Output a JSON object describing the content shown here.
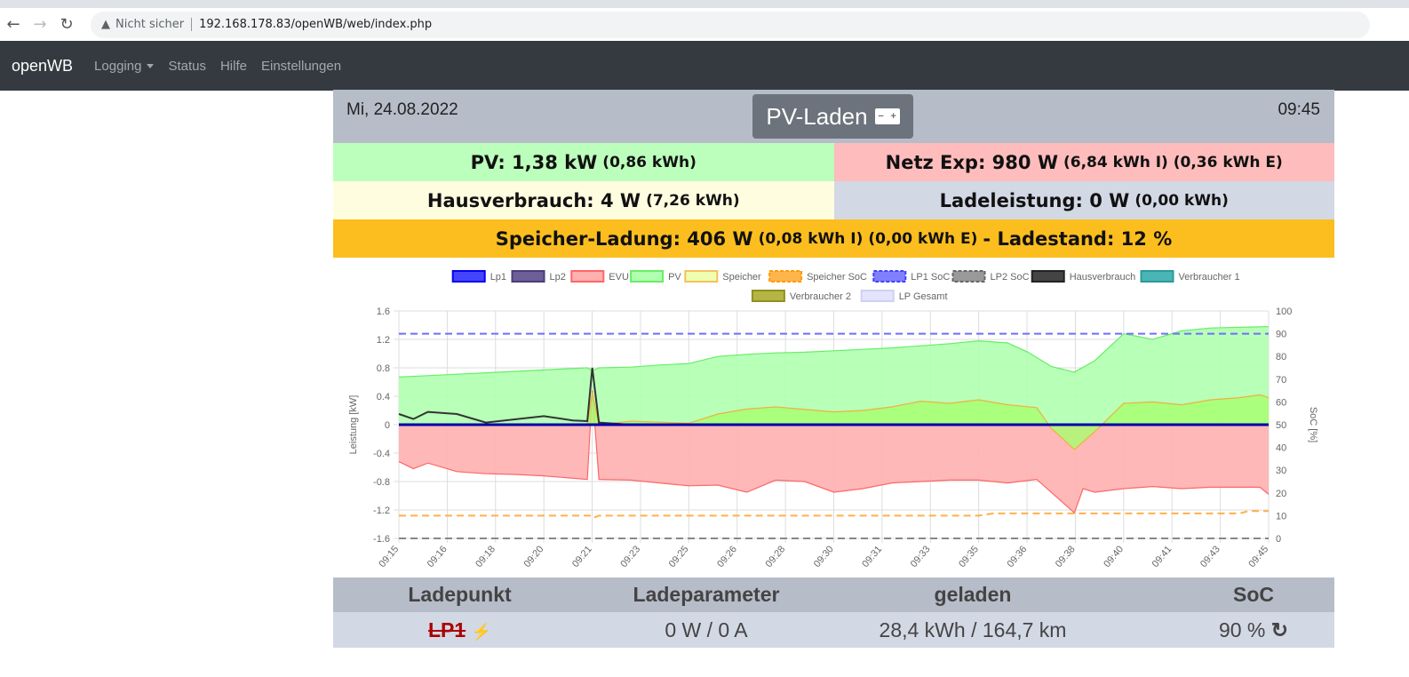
{
  "browser": {
    "security": "Nicht sicher",
    "url": "192.168.178.83/openWB/web/index.php"
  },
  "navbar": {
    "brand": "openWB",
    "items": [
      "Logging",
      "Status",
      "Hilfe",
      "Einstellungen"
    ]
  },
  "header": {
    "date": "Mi, 24.08.2022",
    "mode": "PV-Laden",
    "time": "09:45"
  },
  "stats": {
    "pv": "PV: 1,38 kW",
    "pv_sub": "(0,86 kWh)",
    "netz": "Netz Exp: 980 W",
    "netz_sub": "(6,84 kWh I) (0,36 kWh E)",
    "haus": "Hausverbrauch: 4 W",
    "haus_sub": "(7,26 kWh)",
    "lade": "Ladeleistung: 0 W",
    "lade_sub": "(0,00 kWh)",
    "speicher": "Speicher-Ladung: 406 W",
    "speicher_sub": "(0,08 kWh I) (0,00 kWh E)",
    "ladestand": "- Ladestand: 12 %"
  },
  "colors": {
    "pv": "#bcffbc",
    "netz": "#ffbcbc",
    "haus": "#fffde0",
    "lade": "#d3d8e5",
    "speicher": "#fcbe1e"
  },
  "chart_data": {
    "type": "line",
    "ylabel": "Leistung [kW]",
    "y2label": "SoC [%]",
    "ylim": [
      -1.6,
      1.6
    ],
    "y2lim": [
      0,
      100
    ],
    "yticks": [
      "1.6",
      "1.2",
      "0.8",
      "0.4",
      "0",
      "-0.4",
      "-0.8",
      "-1.2",
      "-1.6"
    ],
    "y2ticks": [
      "100",
      "90",
      "80",
      "70",
      "60",
      "50",
      "40",
      "30",
      "20",
      "10",
      "0"
    ],
    "xticks": [
      "09:15",
      "09:16",
      "09:18",
      "09:20",
      "09:21",
      "09:23",
      "09:25",
      "09:26",
      "09:28",
      "09:30",
      "09:31",
      "09:33",
      "09:35",
      "09:36",
      "09:38",
      "09:40",
      "09:41",
      "09:43",
      "09:45"
    ],
    "xrange_min": [
      0,
      30
    ],
    "legend": [
      {
        "name": "Lp1",
        "fill": "#4444ff",
        "stroke": "#0000ee",
        "dash": false
      },
      {
        "name": "Lp2",
        "fill": "#6c5e96",
        "stroke": "#4a3d78",
        "dash": false
      },
      {
        "name": "EVU",
        "fill": "#ffb0b0",
        "stroke": "#ff6666",
        "dash": false
      },
      {
        "name": "PV",
        "fill": "#b0ffb0",
        "stroke": "#66ee66",
        "dash": false
      },
      {
        "name": "Speicher",
        "fill": "#eeffb0",
        "stroke": "#f5c060",
        "dash": false
      },
      {
        "name": "Speicher SoC",
        "fill": "#ffb44c",
        "stroke": "#ff9900",
        "dash": true
      },
      {
        "name": "LP1 SoC",
        "fill": "#8080ff",
        "stroke": "#4040ff",
        "dash": true
      },
      {
        "name": "LP2 SoC",
        "fill": "#999999",
        "stroke": "#666666",
        "dash": true
      },
      {
        "name": "Hausverbrauch",
        "fill": "#444444",
        "stroke": "#222222",
        "dash": false
      },
      {
        "name": "Verbraucher 1",
        "fill": "#4bb5b5",
        "stroke": "#2a9a9a",
        "dash": false
      },
      {
        "name": "Verbraucher 2",
        "fill": "#b5b545",
        "stroke": "#909020",
        "dash": false
      },
      {
        "name": "LP Gesamt",
        "fill": "#e4e4ff",
        "stroke": "#d0d0f0",
        "dash": false
      }
    ],
    "series": {
      "PV": [
        [
          0,
          0.67
        ],
        [
          1,
          0.69
        ],
        [
          2,
          0.71
        ],
        [
          3,
          0.73
        ],
        [
          4,
          0.75
        ],
        [
          5,
          0.77
        ],
        [
          6.5,
          0.8
        ],
        [
          6.67,
          0.76
        ],
        [
          6.9,
          0.8
        ],
        [
          8,
          0.81
        ],
        [
          9,
          0.84
        ],
        [
          10,
          0.86
        ],
        [
          11,
          0.96
        ],
        [
          12,
          0.99
        ],
        [
          13,
          1.01
        ],
        [
          14,
          1.02
        ],
        [
          15,
          1.04
        ],
        [
          16,
          1.06
        ],
        [
          17,
          1.08
        ],
        [
          18,
          1.11
        ],
        [
          19,
          1.14
        ],
        [
          20,
          1.18
        ],
        [
          21,
          1.15
        ],
        [
          21.7,
          1.02
        ],
        [
          22.5,
          0.82
        ],
        [
          23.3,
          0.74
        ],
        [
          24,
          0.9
        ],
        [
          25,
          1.28
        ],
        [
          26,
          1.2
        ],
        [
          27,
          1.32
        ],
        [
          28,
          1.36
        ],
        [
          29,
          1.37
        ],
        [
          30,
          1.38
        ]
      ],
      "EVU": [
        [
          0,
          -0.52
        ],
        [
          0.5,
          -0.62
        ],
        [
          1,
          -0.54
        ],
        [
          2,
          -0.66
        ],
        [
          3,
          -0.69
        ],
        [
          4,
          -0.7
        ],
        [
          5,
          -0.72
        ],
        [
          6.5,
          -0.77
        ],
        [
          6.67,
          0.48
        ],
        [
          6.9,
          -0.77
        ],
        [
          8,
          -0.78
        ],
        [
          9,
          -0.82
        ],
        [
          10,
          -0.86
        ],
        [
          11,
          -0.85
        ],
        [
          12,
          -0.95
        ],
        [
          13,
          -0.78
        ],
        [
          14,
          -0.8
        ],
        [
          15,
          -0.95
        ],
        [
          16,
          -0.9
        ],
        [
          17,
          -0.82
        ],
        [
          18,
          -0.8
        ],
        [
          19,
          -0.78
        ],
        [
          20,
          -0.78
        ],
        [
          21,
          -0.82
        ],
        [
          22,
          -0.77
        ],
        [
          23.3,
          -1.24
        ],
        [
          23.6,
          -0.9
        ],
        [
          24,
          -0.95
        ],
        [
          25,
          -0.9
        ],
        [
          26,
          -0.87
        ],
        [
          27,
          -0.9
        ],
        [
          28,
          -0.88
        ],
        [
          29,
          -0.88
        ],
        [
          29.7,
          -0.88
        ],
        [
          30,
          -0.98
        ]
      ],
      "Speicher": [
        [
          0,
          0
        ],
        [
          6.5,
          0
        ],
        [
          6.67,
          0.45
        ],
        [
          6.9,
          0
        ],
        [
          8,
          0.05
        ],
        [
          10,
          0.02
        ],
        [
          11,
          0.15
        ],
        [
          12,
          0.22
        ],
        [
          13,
          0.25
        ],
        [
          15,
          0.18
        ],
        [
          16,
          0.2
        ],
        [
          17,
          0.25
        ],
        [
          18,
          0.33
        ],
        [
          19,
          0.3
        ],
        [
          20,
          0.35
        ],
        [
          21,
          0.28
        ],
        [
          22,
          0.24
        ],
        [
          22.5,
          -0.05
        ],
        [
          23.3,
          -0.35
        ],
        [
          24,
          -0.1
        ],
        [
          25,
          0.3
        ],
        [
          26,
          0.32
        ],
        [
          27,
          0.28
        ],
        [
          28,
          0.35
        ],
        [
          29,
          0.38
        ],
        [
          29.7,
          0.42
        ],
        [
          30,
          0.38
        ]
      ],
      "Hausverbrauch": [
        [
          0,
          0.15
        ],
        [
          0.5,
          0.08
        ],
        [
          1,
          0.18
        ],
        [
          2,
          0.15
        ],
        [
          3,
          0.03
        ],
        [
          5,
          0.12
        ],
        [
          6,
          0.06
        ],
        [
          6.5,
          0.05
        ],
        [
          6.67,
          0.8
        ],
        [
          6.9,
          0.03
        ],
        [
          8,
          0
        ],
        [
          30,
          0
        ]
      ],
      "Lp1": [
        [
          0,
          0
        ],
        [
          30,
          0
        ]
      ],
      "LP1 SoC": [
        [
          0,
          90
        ],
        [
          30,
          90
        ]
      ],
      "Speicher SoC": [
        [
          0,
          10
        ],
        [
          6.6,
          10
        ],
        [
          6.7,
          9
        ],
        [
          6.9,
          10
        ],
        [
          20,
          10
        ],
        [
          20.5,
          11
        ],
        [
          29,
          11
        ],
        [
          29.3,
          12
        ],
        [
          30,
          12
        ]
      ],
      "LP2 SoC": [
        [
          0,
          0
        ],
        [
          30,
          0
        ]
      ]
    }
  },
  "table": {
    "headers": [
      "Ladepunkt",
      "Ladeparameter",
      "geladen",
      "SoC"
    ],
    "row": {
      "name": "LP1",
      "params": "0 W / 0 A",
      "charged": "28,4 kWh / 164,7 km",
      "soc": "90 %"
    }
  }
}
